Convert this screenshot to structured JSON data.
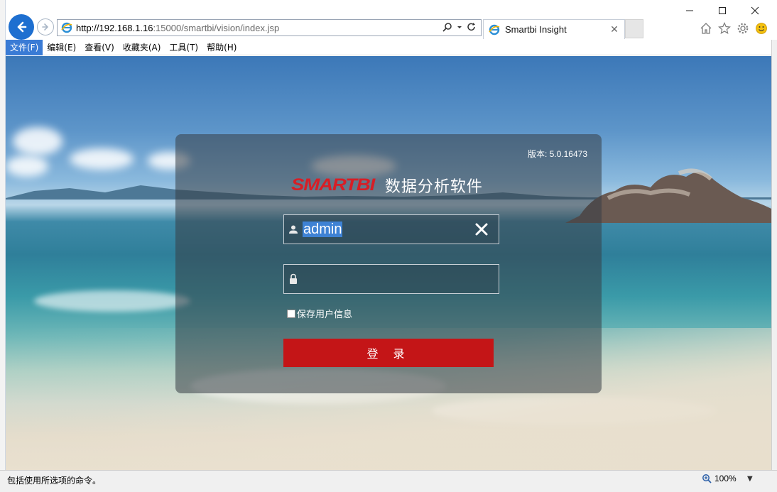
{
  "browser": {
    "address": {
      "host": "http://192.168.1.16",
      "path": ":15000/smartbi/vision/index.jsp"
    },
    "tab": {
      "title": "Smartbi Insight"
    }
  },
  "menu": {
    "items": [
      {
        "label": "文件(F)",
        "active": true
      },
      {
        "label": "编辑(E)"
      },
      {
        "label": "查看(V)"
      },
      {
        "label": "收藏夹(A)"
      },
      {
        "label": "工具(T)"
      },
      {
        "label": "帮助(H)"
      }
    ]
  },
  "login": {
    "version": "版本: 5.0.16473",
    "brand_logo": "SMARTBI",
    "brand_subtitle": "数据分析软件",
    "username": "admin",
    "password": "",
    "remember_label": "保存用户信息",
    "login_button": "登 录"
  },
  "status": {
    "text": "包括使用所选项的命令。",
    "zoom": "100%"
  },
  "colors": {
    "accent_blue": "#1e6fd0",
    "brand_red": "#d71e26",
    "login_button": "#c41517"
  }
}
